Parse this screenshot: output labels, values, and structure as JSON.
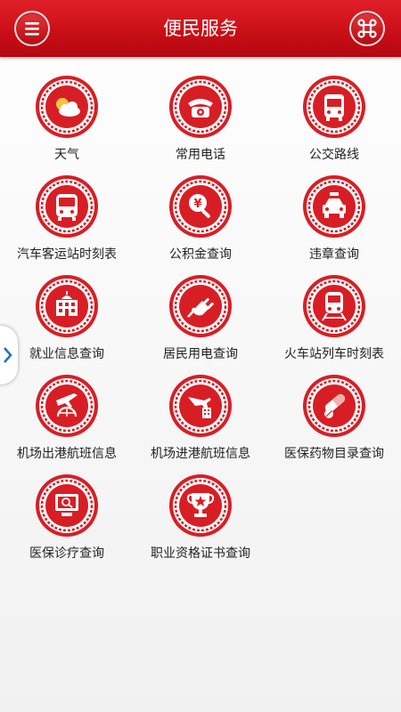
{
  "header": {
    "title": "便民服务",
    "left_icon": "menu-icon",
    "right_icon": "command-icon"
  },
  "colors": {
    "brand_red": "#d2121a",
    "badge_red": "#d81e25",
    "text": "#222222"
  },
  "services": [
    {
      "label": "天气",
      "icon": "weather-icon"
    },
    {
      "label": "常用电话",
      "icon": "telephone-icon"
    },
    {
      "label": "公交路线",
      "icon": "bus-icon"
    },
    {
      "label": "汽车客运站时刻表",
      "icon": "coach-icon"
    },
    {
      "label": "公积金查询",
      "icon": "yuan-search-icon"
    },
    {
      "label": "违章查询",
      "icon": "traffic-police-car-icon"
    },
    {
      "label": "就业信息查询",
      "icon": "office-building-icon"
    },
    {
      "label": "居民用电查询",
      "icon": "power-plug-icon"
    },
    {
      "label": "火车站列车时刻表",
      "icon": "train-icon"
    },
    {
      "label": "机场出港航班信息",
      "icon": "departure-plane-globe-icon"
    },
    {
      "label": "机场进港航班信息",
      "icon": "arrival-plane-building-icon"
    },
    {
      "label": "医保药物目录查询",
      "icon": "pill-capsule-icon"
    },
    {
      "label": "医保诊疗查询",
      "icon": "monitor-search-icon"
    },
    {
      "label": "职业资格证书查询",
      "icon": "trophy-star-icon"
    }
  ],
  "side_tab_icon": "chevron-right-icon"
}
